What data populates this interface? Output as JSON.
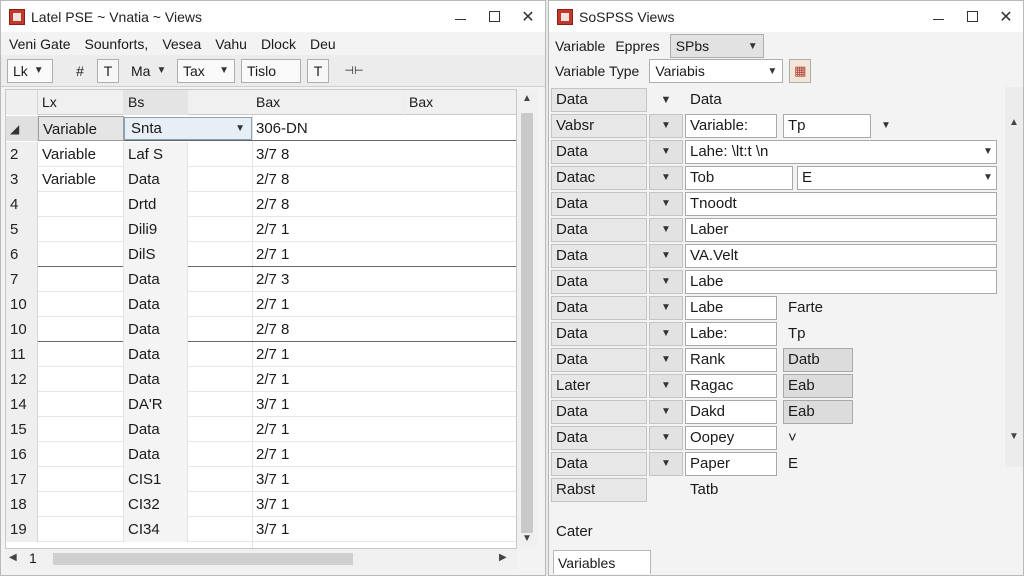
{
  "left_window": {
    "title": "Latel PSE ~ Vnatia ~ Views",
    "menu": [
      "Veni Gate",
      "Sounforts,",
      "Vesea",
      "Vahu",
      "Dlock",
      "Deu"
    ],
    "toolbar": {
      "combo1": "Lk",
      "btn_hash": "#",
      "btn_fmt": "T",
      "combo2": "Ma",
      "combo3": "Tax",
      "field": "Tislo",
      "btn_t": "T",
      "btn_split": "⊣⊢"
    },
    "grid": {
      "headers": [
        "Lx",
        "Bs",
        "Bax",
        "Bax"
      ],
      "first_row": {
        "a": "Variable",
        "b": "Snta",
        "c": "306-DN"
      },
      "rows": [
        {
          "num": "2",
          "a": "Variable",
          "b": "Laf S",
          "c": "3/7 8"
        },
        {
          "num": "3",
          "a": "Variable",
          "b": "Data",
          "c": "2/7 8"
        },
        {
          "num": "4",
          "a": "",
          "b": "Drtd",
          "c": "2/7 8"
        },
        {
          "num": "5",
          "a": "",
          "b": "Dili9",
          "c": "2/7 1"
        },
        {
          "num": "6",
          "a": "",
          "b": "DilS",
          "c": "2/7 1"
        },
        {
          "num": "7",
          "a": "",
          "b": "Data",
          "c": "2/7 3"
        },
        {
          "num": "10",
          "a": "",
          "b": "Data",
          "c": "2/7 1"
        },
        {
          "num": "10",
          "a": "",
          "b": "Data",
          "c": "2/7 8"
        },
        {
          "num": "11",
          "a": "",
          "b": "Data",
          "c": "2/7 1"
        },
        {
          "num": "12",
          "a": "",
          "b": "Data",
          "c": "2/7 1"
        },
        {
          "num": "14",
          "a": "",
          "b": "DA'R",
          "c": "3/7 1"
        },
        {
          "num": "15",
          "a": "",
          "b": "Data",
          "c": "2/7 1"
        },
        {
          "num": "16",
          "a": "",
          "b": "Data",
          "c": "2/7 1"
        },
        {
          "num": "17",
          "a": "",
          "b": "CIS1",
          "c": "3/7 1"
        },
        {
          "num": "18",
          "a": "",
          "b": "CI32",
          "c": "3/7 1"
        },
        {
          "num": "19",
          "a": "",
          "b": "CI34",
          "c": "3/7 1"
        }
      ]
    },
    "hscroll_page": "1"
  },
  "right_window": {
    "title": "SoSPSS Views",
    "menu": [
      "Variable",
      "Eppres"
    ],
    "menu_combo": "SPbs",
    "variable_type_label": "Variable Type",
    "variable_type_value": "Variabis",
    "header": {
      "label": "Data",
      "value": "Data"
    },
    "rows": [
      {
        "label": "Vabsr",
        "f1": "Variable:",
        "f2": "Tp",
        "f2_dd": true
      },
      {
        "label": "Data",
        "f1": "Lahe: \\lt:t \\n",
        "wide": true
      },
      {
        "label": "Datac",
        "f1": "Tob",
        "f2": "E",
        "f2_combo": true
      },
      {
        "label": "Data",
        "f1": "Tnoodt",
        "wide": true
      },
      {
        "label": "Data",
        "f1": "Laber",
        "wide": true
      },
      {
        "label": "Data",
        "f1": "VA.Velt",
        "wide": true
      },
      {
        "label": "Data",
        "f1": "Labe",
        "wide": true
      },
      {
        "label": "Data",
        "f1": "Labe",
        "f2": "Farte"
      },
      {
        "label": "Data",
        "f1": "Labe:",
        "f2": "Tp"
      },
      {
        "label": "Data",
        "f1": "Rank",
        "f2": "Datb",
        "f2_grey": true
      },
      {
        "label": "Later",
        "f1": "Ragac",
        "f2": "Eab",
        "f2_grey": true
      },
      {
        "label": "Data",
        "f1": "Dakd",
        "f2": "Eab",
        "f2_grey": true
      },
      {
        "label": "Data",
        "f1": "Oopey",
        "f2": "˅"
      },
      {
        "label": "Data",
        "f1": "Paper",
        "f2": "E"
      },
      {
        "label": "Rabst",
        "f1": "Tatb",
        "plain_f1": true
      }
    ],
    "footer_label": "Cater",
    "bottom_tab": "Variables"
  }
}
